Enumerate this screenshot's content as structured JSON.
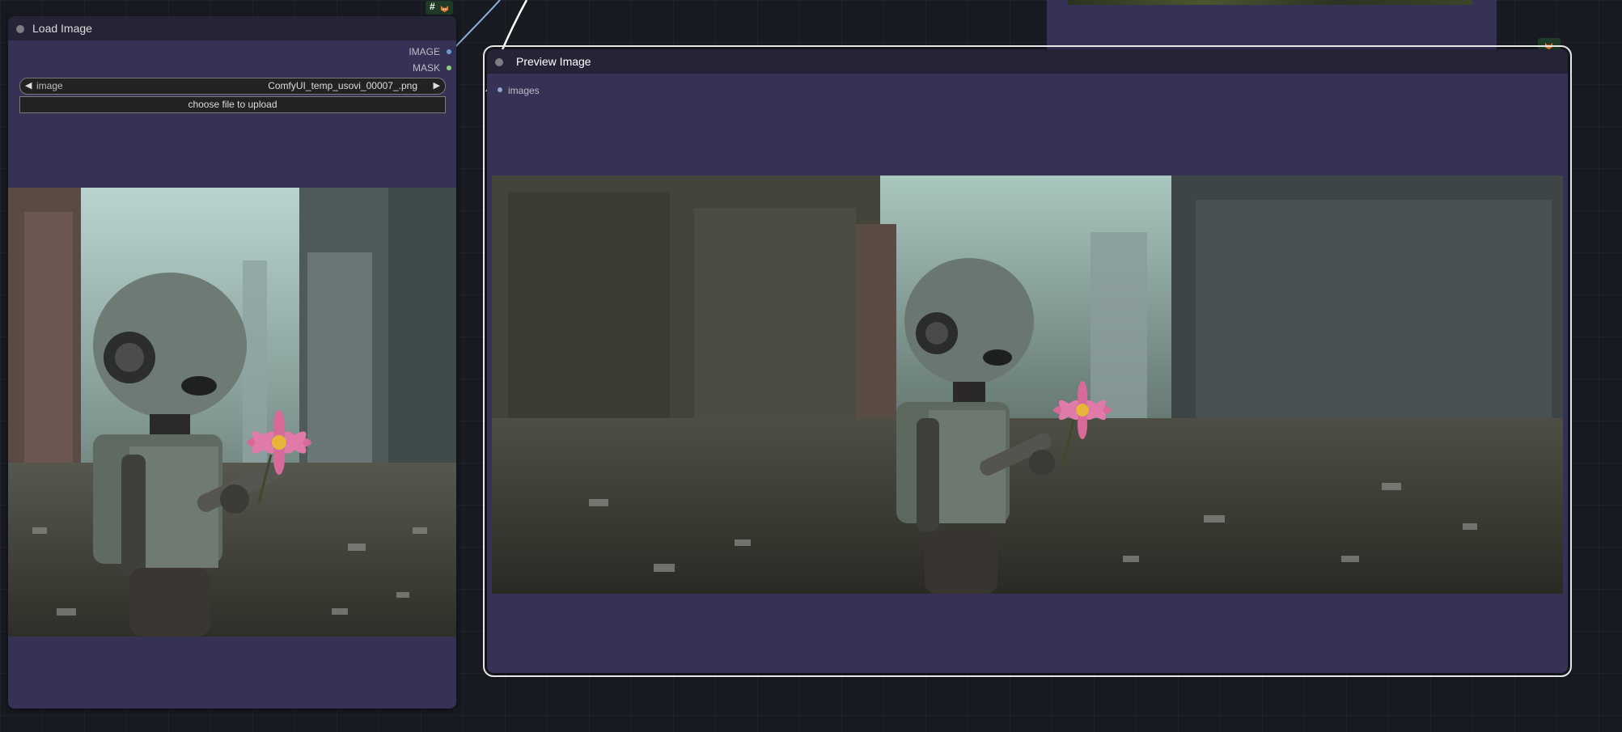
{
  "load_image": {
    "title": "Load Image",
    "outputs": [
      {
        "label": "IMAGE",
        "color": "#6c9ad3"
      },
      {
        "label": "MASK",
        "color": "#8fd17a"
      }
    ],
    "image_widget": {
      "name": "image",
      "value": "ComfyUI_temp_usovi_00007_.png"
    },
    "upload_label": "choose file to upload"
  },
  "preview_image": {
    "title": "Preview Image",
    "input_label": "images",
    "input_color": "#8fa5d6"
  },
  "badge": {
    "label": "#"
  },
  "colors": {
    "canvas": "#181a22",
    "node_body": "#353256",
    "node_header": "#252437",
    "link_image": "#8fb2d8",
    "link_white": "#ffffff"
  },
  "icons": [
    "fox-icon",
    "node-status-dot"
  ]
}
